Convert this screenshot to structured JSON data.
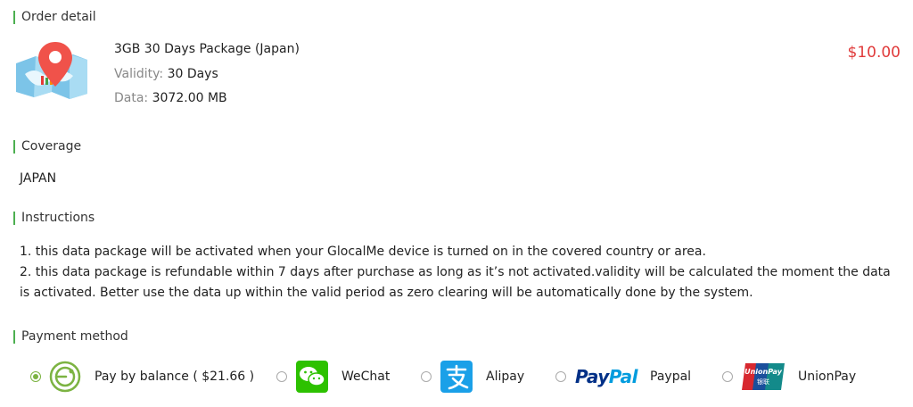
{
  "sections": {
    "order_detail": "Order detail",
    "coverage": "Coverage",
    "instructions": "Instructions",
    "payment_method": "Payment method"
  },
  "package": {
    "name": "3GB 30 Days Package (Japan)",
    "validity_label": "Validity:",
    "validity_value": "30 Days",
    "data_label": "Data:",
    "data_value": "3072.00 MB",
    "price": "$10.00",
    "icon": "map-pin-icon"
  },
  "coverage": {
    "value": "JAPAN"
  },
  "instructions": {
    "line1": "1. this data package will be activated when your GlocalMe device is turned on in the covered country or area.",
    "line2": "2. this data package is refundable within 7 days after purchase as long as it’s not activated.validity will be calculated the moment the data is activated. Better use the data up within the valid period as zero clearing will be automatically done by the system."
  },
  "payment": {
    "selected": "balance",
    "methods": [
      {
        "id": "balance",
        "label": "Pay by balance ( $21.66 )",
        "icon": "balance-icon"
      },
      {
        "id": "wechat",
        "label": "WeChat",
        "icon": "wechat-icon"
      },
      {
        "id": "alipay",
        "label": "Alipay",
        "icon": "alipay-icon"
      },
      {
        "id": "paypal",
        "label": "Paypal",
        "icon": "paypal-icon",
        "logo_text_1": "Pay",
        "logo_text_2": "Pal"
      },
      {
        "id": "unionpay",
        "label": "UnionPay",
        "icon": "unionpay-icon",
        "logo_text": "UnionPay",
        "logo_subtext": "银联"
      }
    ]
  },
  "colors": {
    "accent_green": "#4caf50",
    "price_red": "#e03a3a",
    "radio_green": "#7cb342",
    "wechat_green": "#2dc100",
    "alipay_blue": "#1aa0e8",
    "paypal_dark": "#003087",
    "paypal_light": "#009cde"
  }
}
